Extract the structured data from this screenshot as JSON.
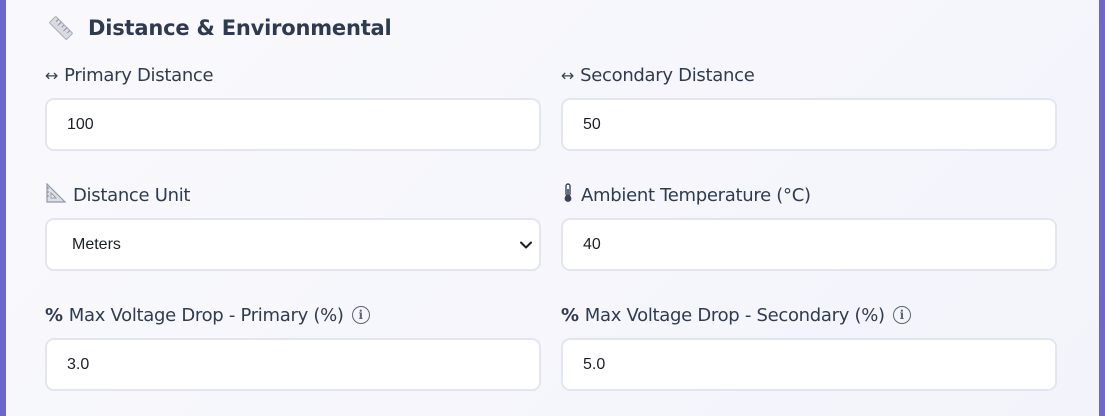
{
  "section": {
    "title": "Distance & Environmental",
    "icon": "ruler-icon"
  },
  "fields": {
    "primary_distance": {
      "icon": "↔",
      "label": "Primary Distance",
      "value": "100"
    },
    "secondary_distance": {
      "icon": "↔",
      "label": "Secondary Distance",
      "value": "50"
    },
    "distance_unit": {
      "icon": "triangular-ruler-icon",
      "label": "Distance Unit",
      "selected": "Meters"
    },
    "ambient_temperature": {
      "icon": "thermometer-icon",
      "label": "Ambient Temperature (°C)",
      "value": "40"
    },
    "max_vd_primary": {
      "icon": "%",
      "label": "Max Voltage Drop - Primary (%)",
      "value": "3.0",
      "info_glyph": "i"
    },
    "max_vd_secondary": {
      "icon": "%",
      "label": "Max Voltage Drop - Secondary (%)",
      "value": "5.0",
      "info_glyph": "i"
    }
  },
  "colors": {
    "frame": "#6b68c9",
    "panel_bg": "#f5f6fc",
    "title_text": "#2d3a4f",
    "input_border": "#e3e6ee"
  }
}
